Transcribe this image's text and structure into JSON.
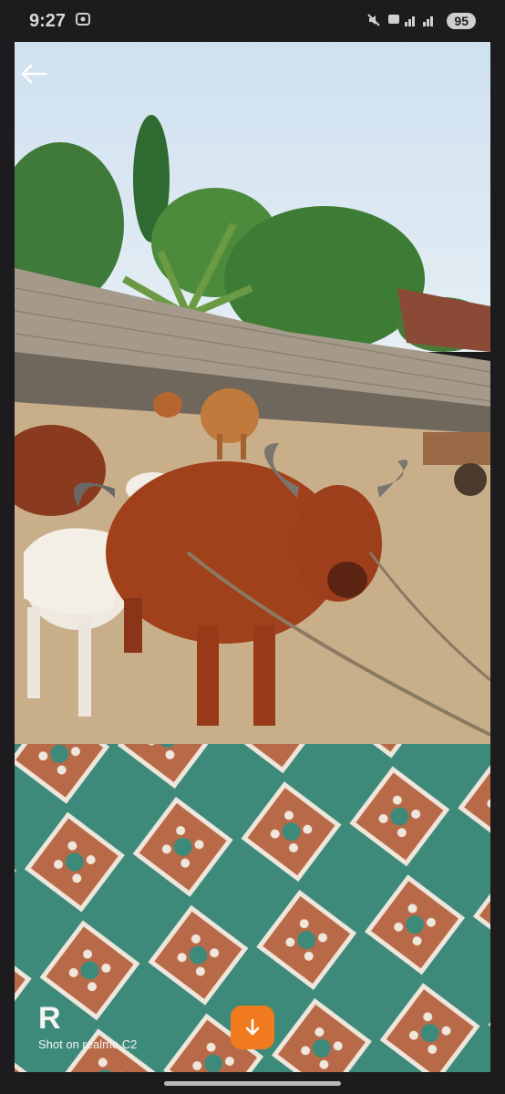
{
  "status": {
    "time": "9:27",
    "battery": "95"
  },
  "photo": {
    "subject": "cattle-in-yard"
  },
  "watermark": {
    "logo": "R",
    "text": "Shot on realme C2"
  },
  "icons": {
    "back": "arrow-left-icon",
    "download": "arrow-down-icon"
  },
  "colors": {
    "accent": "#f27a1f",
    "background": "#1c1c1e"
  }
}
